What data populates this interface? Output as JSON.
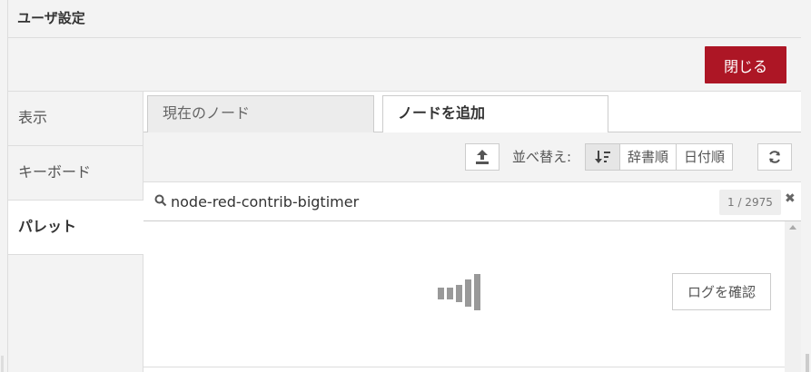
{
  "dialog": {
    "title": "ユーザ設定",
    "close_label": "閉じる"
  },
  "sidebar": {
    "items": [
      {
        "label": "表示"
      },
      {
        "label": "キーボード"
      },
      {
        "label": "パレット",
        "active": true
      }
    ]
  },
  "tabs": [
    {
      "label": "現在のノード"
    },
    {
      "label": "ノードを追加",
      "active": true
    }
  ],
  "toolbar": {
    "sort_label": "並べ替え:",
    "sort_options": [
      "辞書順",
      "日付順"
    ],
    "upload_icon": "upload-icon",
    "sort_icon": "sort-desc-icon",
    "refresh_icon": "refresh-icon"
  },
  "search": {
    "value": "node-red-contrib-bigtimer",
    "result_count": "1 / 2975"
  },
  "content": {
    "log_button_label": "ログを確認"
  },
  "colors": {
    "accent": "#ad1625"
  }
}
